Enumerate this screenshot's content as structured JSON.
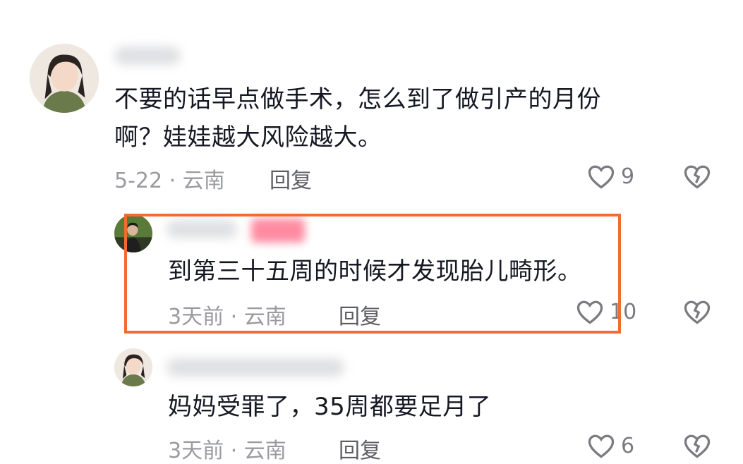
{
  "comments": [
    {
      "text_line1": "不要的话早点做手术，怎么到了做引产的月份",
      "text_line2": "啊？娃娃越大风险越大。",
      "meta": "5-22 · 云南",
      "reply_label": "回复",
      "like_count": "9"
    },
    {
      "text": "到第三十五周的时候才发现胎儿畸形。",
      "meta": "3天前 · 云南",
      "reply_label": "回复",
      "like_count": "10"
    },
    {
      "text": "妈妈受罪了，35周都要足月了",
      "meta": "3天前 · 云南",
      "reply_label": "回复",
      "like_count": "6"
    }
  ],
  "colors": {
    "highlight_border": "#f26b33",
    "author_badge": "#fe2c55",
    "text": "#161823",
    "meta": "#9a9ba0"
  },
  "icons": [
    "heart-outline-icon",
    "broken-heart-icon"
  ]
}
